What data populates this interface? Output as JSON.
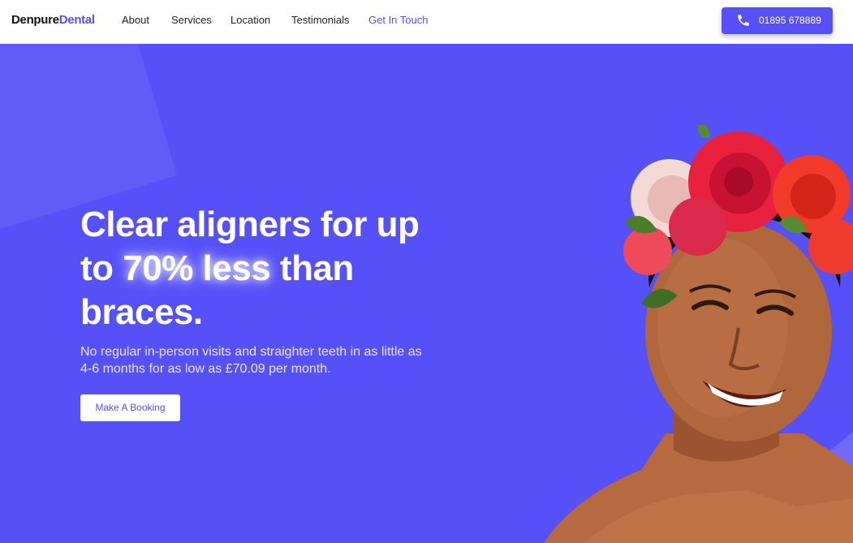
{
  "brand": {
    "name_part1": "Denpure",
    "name_part2": "Dental"
  },
  "nav": {
    "items": [
      {
        "label": "About"
      },
      {
        "label": "Services"
      },
      {
        "label": "Location"
      },
      {
        "label": "Testimonials"
      },
      {
        "label": "Get In Touch"
      }
    ]
  },
  "phone": {
    "number": "01895 678889",
    "icon": "phone-icon"
  },
  "hero": {
    "headline_part1": "Clear aligners for up to ",
    "headline_highlight": "70% less",
    "headline_part2": " than braces.",
    "subtext": "No regular in-person visits and straighter teeth in as little as 4-6 months for as low as £70.09 per month.",
    "cta_label": "Make A Booking"
  },
  "colors": {
    "accent": "#574ff7",
    "hero_bg": "#5550f7",
    "white": "#ffffff"
  }
}
